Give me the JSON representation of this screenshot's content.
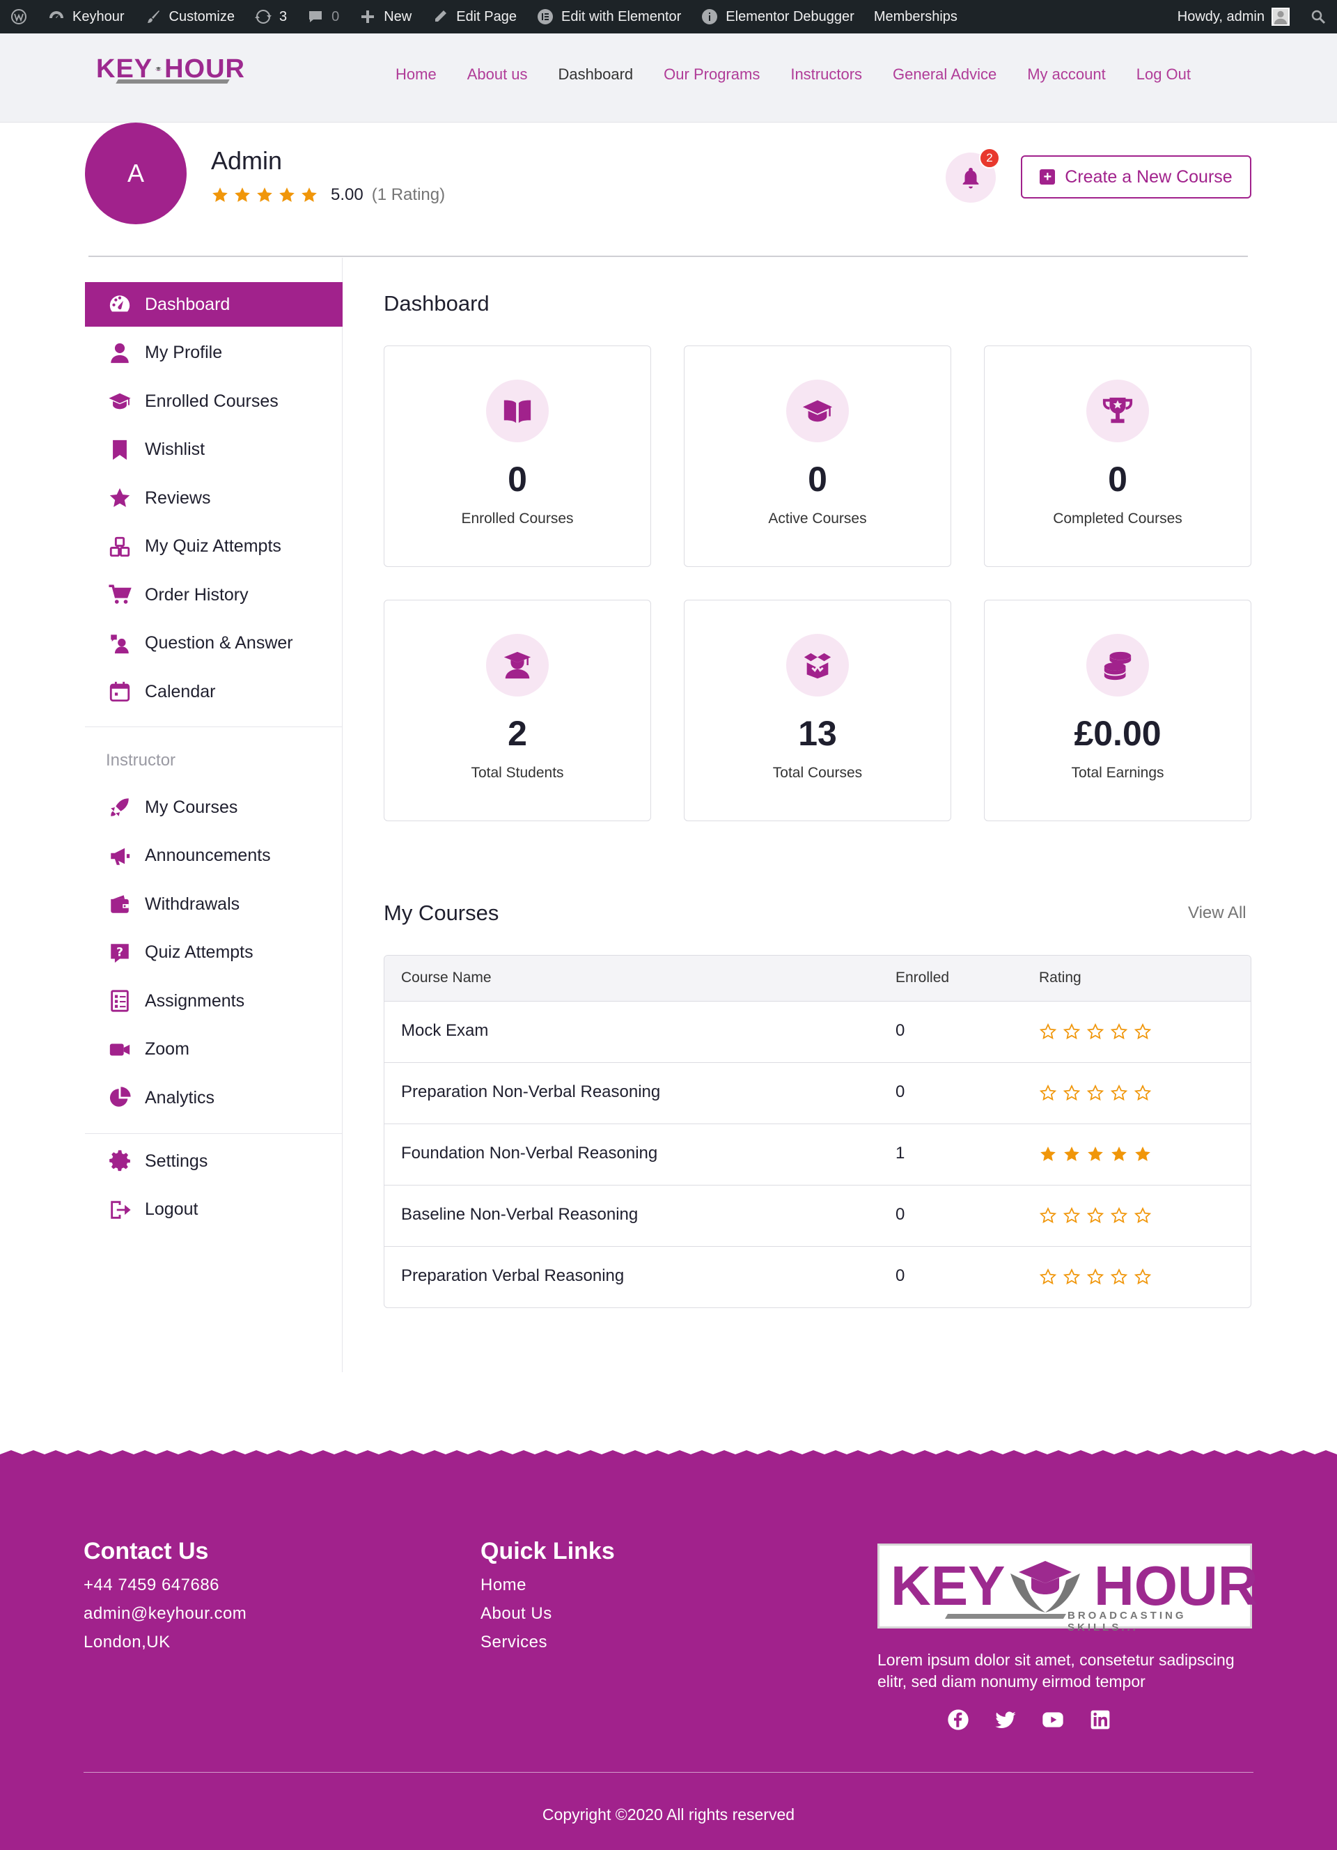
{
  "adminbar": {
    "site": "Keyhour",
    "customize": "Customize",
    "updates": "3",
    "comments": "0",
    "new": "New",
    "edit_page": "Edit Page",
    "edit_elementor": "Edit with Elementor",
    "debugger": "Elementor Debugger",
    "memberships": "Memberships",
    "howdy": "Howdy, admin"
  },
  "nav": [
    "Home",
    "About us",
    "Dashboard",
    "Our Programs",
    "Instructors",
    "General Advice",
    "My account",
    "Log Out"
  ],
  "nav_active": "Dashboard",
  "logo": {
    "left": "KEY",
    "right": "HOUR"
  },
  "profile": {
    "initial": "A",
    "name": "Admin",
    "rating": 5,
    "rating_value": "5.00",
    "rating_count": "(1 Rating)",
    "notifications": "2",
    "create_course": "Create a New Course"
  },
  "sidebar": {
    "items": [
      {
        "label": "Dashboard",
        "icon": "dashboard-icon",
        "active": true
      },
      {
        "label": "My Profile",
        "icon": "user-icon"
      },
      {
        "label": "Enrolled Courses",
        "icon": "graduation-cap-icon"
      },
      {
        "label": "Wishlist",
        "icon": "bookmark-icon"
      },
      {
        "label": "Reviews",
        "icon": "star-icon"
      },
      {
        "label": "My Quiz Attempts",
        "icon": "quiz-icon"
      },
      {
        "label": "Order History",
        "icon": "cart-icon"
      },
      {
        "label": "Question & Answer",
        "icon": "question-answer-icon"
      },
      {
        "label": "Calendar",
        "icon": "calendar-icon"
      }
    ],
    "instructor_heading": "Instructor",
    "instructor_items": [
      {
        "label": "My Courses",
        "icon": "rocket-icon"
      },
      {
        "label": "Announcements",
        "icon": "megaphone-icon"
      },
      {
        "label": "Withdrawals",
        "icon": "wallet-icon"
      },
      {
        "label": "Quiz Attempts",
        "icon": "quiz-question-icon"
      },
      {
        "label": "Assignments",
        "icon": "assignments-icon"
      },
      {
        "label": "Zoom",
        "icon": "video-icon"
      },
      {
        "label": "Analytics",
        "icon": "pie-chart-icon"
      }
    ],
    "bottom_items": [
      {
        "label": "Settings",
        "icon": "gear-icon"
      },
      {
        "label": "Logout",
        "icon": "logout-icon"
      }
    ]
  },
  "dashboard": {
    "title": "Dashboard",
    "stats": [
      {
        "value": "0",
        "label": "Enrolled Courses",
        "icon": "book-icon"
      },
      {
        "value": "0",
        "label": "Active Courses",
        "icon": "graduation-cap-icon"
      },
      {
        "value": "0",
        "label": "Completed Courses",
        "icon": "trophy-icon"
      },
      {
        "value": "2",
        "label": "Total Students",
        "icon": "student-icon"
      },
      {
        "value": "13",
        "label": "Total Courses",
        "icon": "box-icon"
      },
      {
        "value": "£0.00",
        "label": "Total Earnings",
        "icon": "coins-icon"
      }
    ]
  },
  "courses": {
    "title": "My Courses",
    "view_all": "View All",
    "columns": [
      "Course Name",
      "Enrolled",
      "Rating"
    ],
    "rows": [
      {
        "name": "Mock Exam",
        "enrolled": "0",
        "rating": 0
      },
      {
        "name": "Preparation Non-Verbal Reasoning",
        "enrolled": "0",
        "rating": 0
      },
      {
        "name": "Foundation Non-Verbal Reasoning",
        "enrolled": "1",
        "rating": 5
      },
      {
        "name": "Baseline Non-Verbal Reasoning",
        "enrolled": "0",
        "rating": 0
      },
      {
        "name": "Preparation Verbal Reasoning",
        "enrolled": "0",
        "rating": 0
      }
    ]
  },
  "footer": {
    "contact_title": "Contact Us",
    "phone": "+44 7459 647686",
    "email": "admin@keyhour.com",
    "location": "London,UK",
    "links_title": "Quick Links",
    "links": [
      "Home",
      "About Us",
      "Services"
    ],
    "logo_left": "KEY",
    "logo_right": "HOUR",
    "logo_tag": "BROADCASTING SKILLS...",
    "description": "Lorem ipsum dolor sit amet, consetetur sadipscing elitr, sed diam nonumy eirmod tempor",
    "social": [
      "facebook-icon",
      "twitter-icon",
      "youtube-icon",
      "linkedin-icon"
    ],
    "copyright": "Copyright ©2020 All rights reserved"
  },
  "colors": {
    "brand": "#a1228c",
    "star": "#f0960a",
    "badge": "#e8382d"
  }
}
